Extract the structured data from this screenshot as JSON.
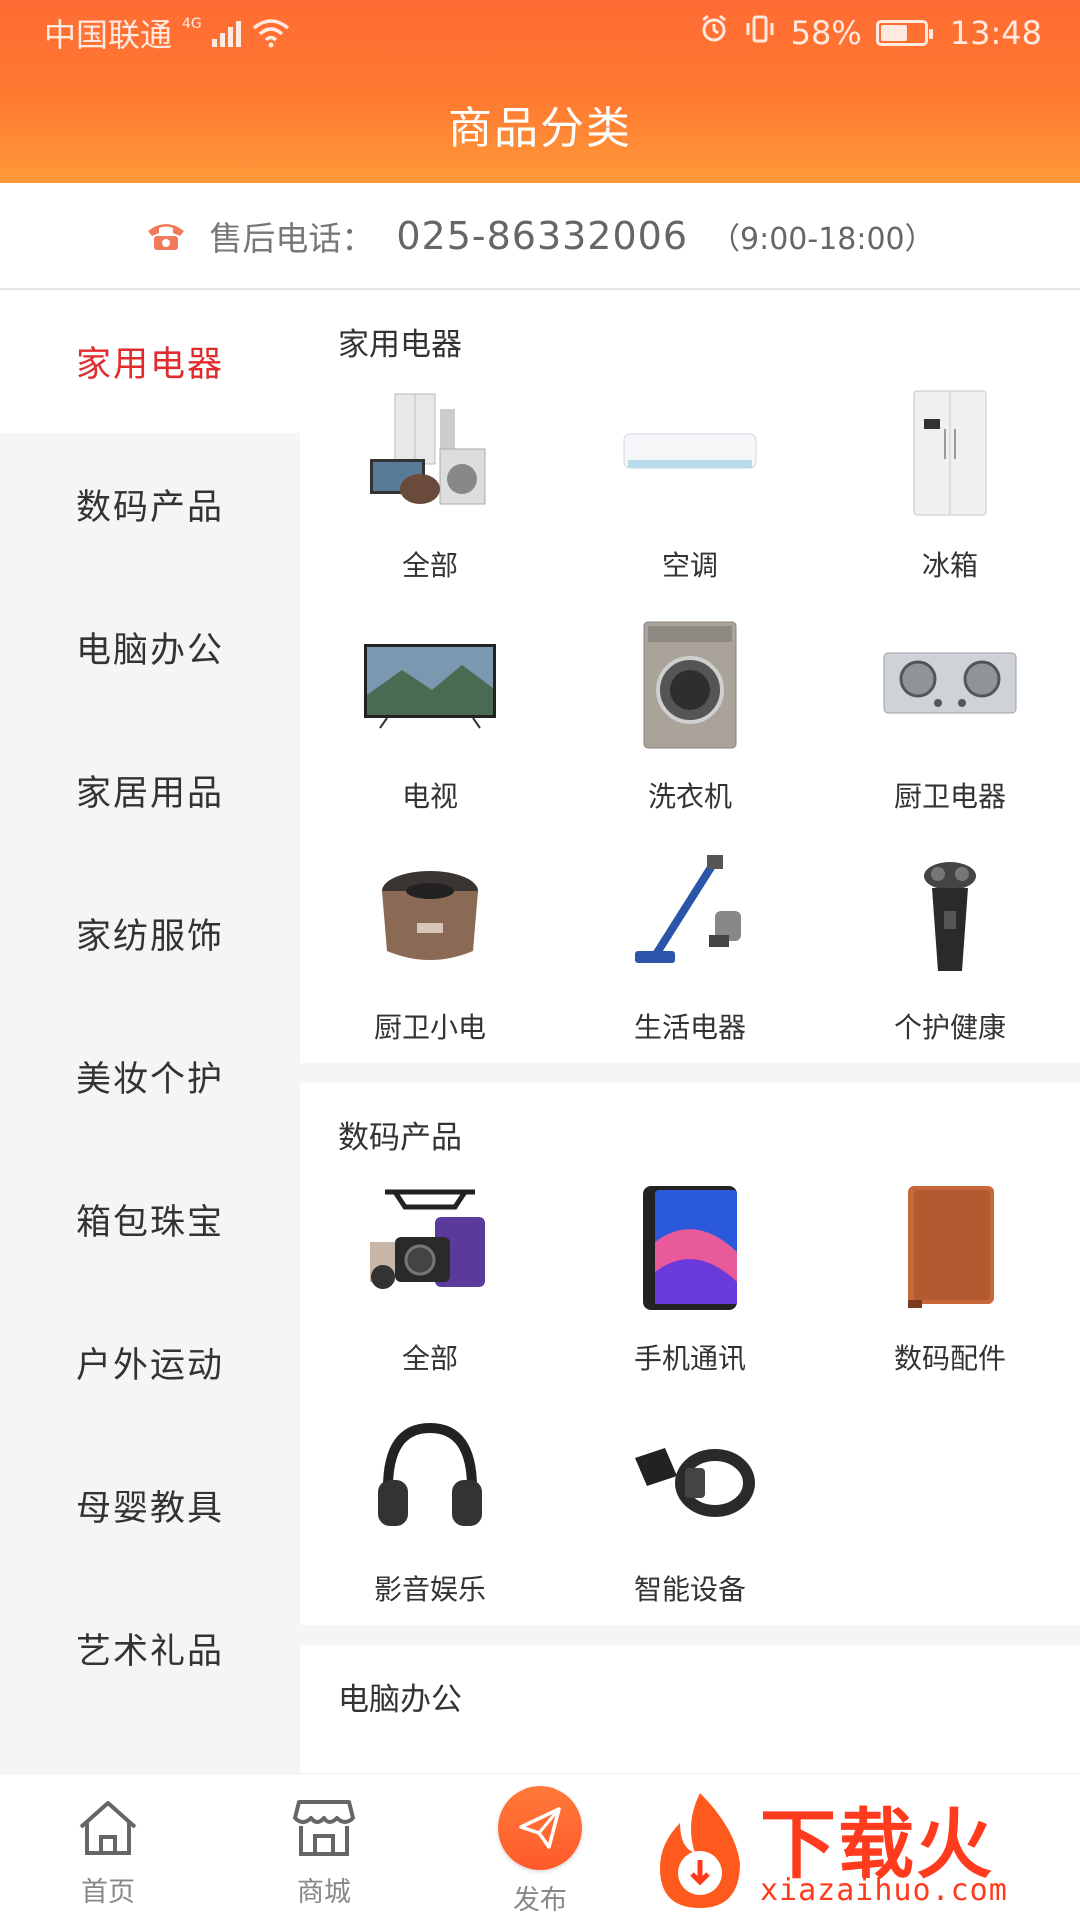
{
  "statusbar": {
    "carrier": "中国联通",
    "network": "4G",
    "battery_percent": "58%",
    "battery_level": 0.58,
    "time": "13:48"
  },
  "header": {
    "title": "商品分类"
  },
  "service": {
    "label": "售后电话：",
    "number": "025-86332006",
    "hours": "（9:00-18:00）"
  },
  "sidebar": {
    "items": [
      {
        "label": "家用电器",
        "active": true
      },
      {
        "label": "数码产品"
      },
      {
        "label": "电脑办公"
      },
      {
        "label": "家居用品"
      },
      {
        "label": "家纺服饰"
      },
      {
        "label": "美妆个护"
      },
      {
        "label": "箱包珠宝"
      },
      {
        "label": "户外运动"
      },
      {
        "label": "母婴教具"
      },
      {
        "label": "艺术礼品"
      }
    ]
  },
  "sections": [
    {
      "title": "家用电器",
      "items": [
        {
          "label": "全部",
          "icon": "appliances-bundle-icon"
        },
        {
          "label": "空调",
          "icon": "air-conditioner-icon"
        },
        {
          "label": "冰箱",
          "icon": "refrigerator-icon"
        },
        {
          "label": "电视",
          "icon": "tv-icon"
        },
        {
          "label": "洗衣机",
          "icon": "washing-machine-icon"
        },
        {
          "label": "厨卫电器",
          "icon": "gas-stove-icon"
        },
        {
          "label": "厨卫小电",
          "icon": "rice-cooker-icon"
        },
        {
          "label": "生活电器",
          "icon": "vacuum-cleaner-icon"
        },
        {
          "label": "个护健康",
          "icon": "shaver-icon"
        }
      ]
    },
    {
      "title": "数码产品",
      "items": [
        {
          "label": "全部",
          "icon": "digital-bundle-icon"
        },
        {
          "label": "手机通讯",
          "icon": "smartphone-icon"
        },
        {
          "label": "数码配件",
          "icon": "tablet-case-icon"
        },
        {
          "label": "影音娱乐",
          "icon": "headphones-icon"
        },
        {
          "label": "智能设备",
          "icon": "smart-band-icon"
        }
      ]
    },
    {
      "title": "电脑办公",
      "items": []
    }
  ],
  "bottom_nav": {
    "home": "首页",
    "mall": "商城",
    "publish": "发布"
  },
  "watermark": {
    "text": "下载火",
    "url": "xiazaihuo.com"
  },
  "colors": {
    "header_start": "#ff6b33",
    "header_end": "#ff9a3a",
    "active_text": "#e02c2c",
    "accent": "#ff5a2a",
    "service_icon": "#f07a5a"
  }
}
